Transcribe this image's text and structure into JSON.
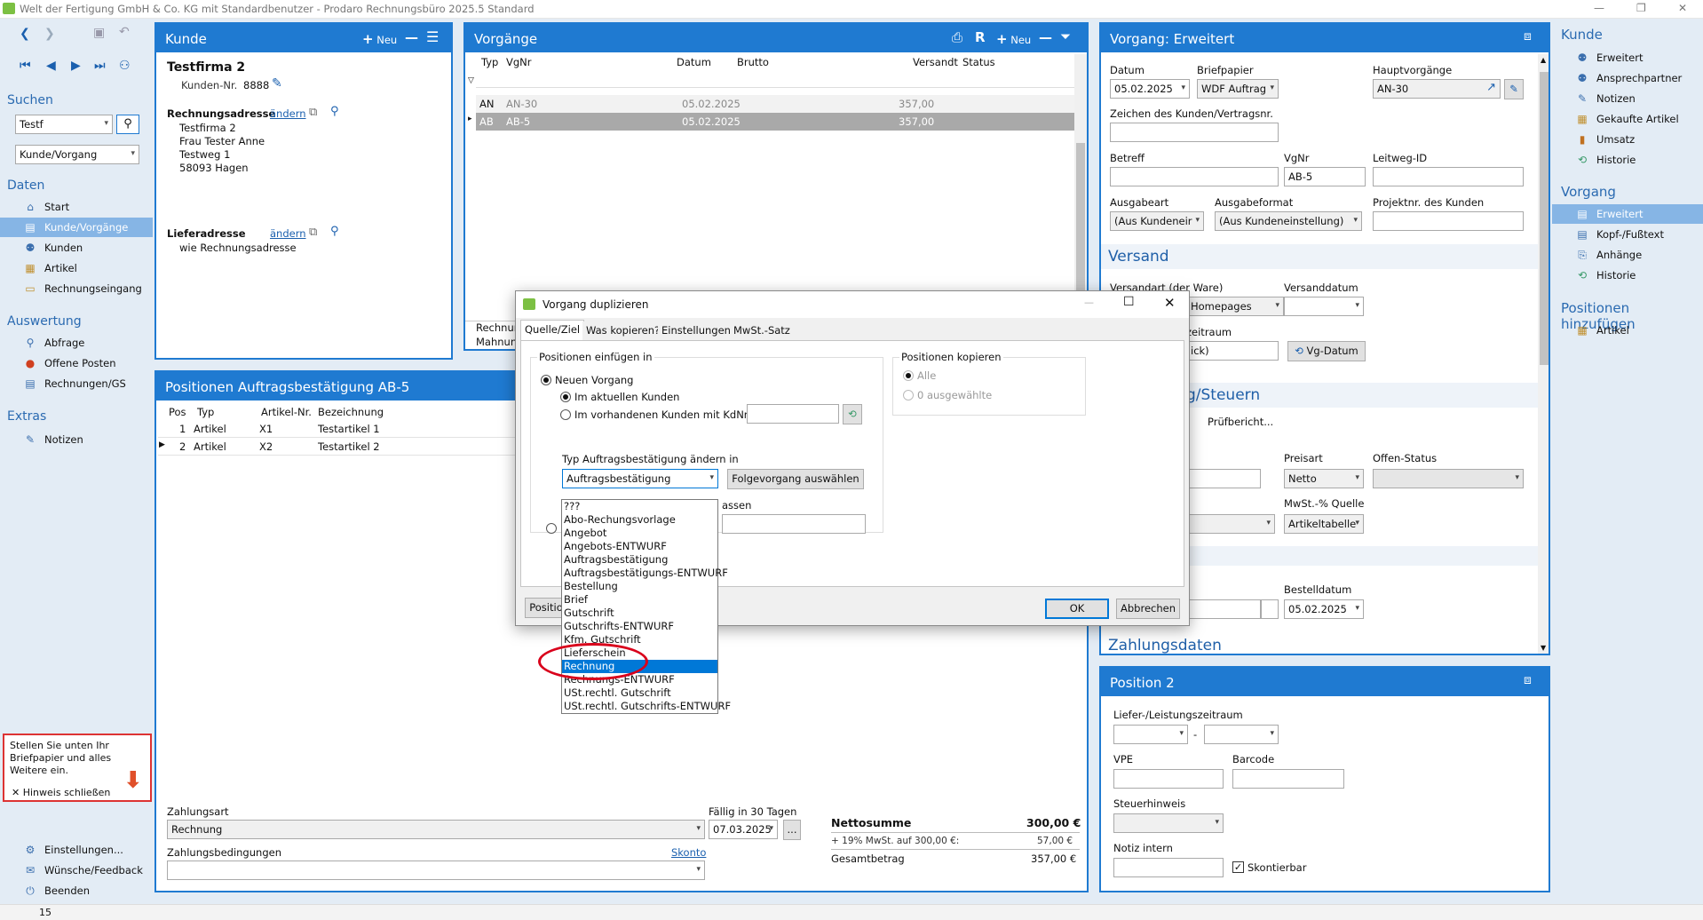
{
  "window": {
    "title": "Welt der Fertigung GmbH & Co. KG mit Standardbenutzer  -  Prodaro Rechnungsbüro 2025.5 Standard",
    "minimize": "—",
    "restore": "❐",
    "close": "✕"
  },
  "left_nav": {
    "search_heading": "Suchen",
    "search_value": "Testf",
    "search_scope": "Kunde/Vorgang",
    "daten_heading": "Daten",
    "daten_items": [
      "Start",
      "Kunde/Vorgänge",
      "Kunden",
      "Artikel",
      "Rechnungseingang"
    ],
    "auswertung_heading": "Auswertung",
    "auswertung_items": [
      "Abfrage",
      "Offene Posten",
      "Rechnungen/GS"
    ],
    "extras_heading": "Extras",
    "extras_items": [
      "Notizen"
    ],
    "bottom_items": [
      "Einstellungen...",
      "Wünsche/Feedback",
      "Beenden"
    ],
    "hint_text": "Stellen Sie unten Ihr Briefpapier und alles Weitere ein.",
    "hint_close": "Hinweis schließen"
  },
  "kunde": {
    "header": "Kunde",
    "new_label": "Neu",
    "name": "Testfirma 2",
    "kundennr_label": "Kunden-Nr.",
    "kundennr": "8888",
    "rechnungsadresse_label": "Rechnungsadresse",
    "aendern": "ändern",
    "address": [
      "Testfirma 2",
      "Frau Tester Anne",
      "Testweg 1",
      "58093 Hagen"
    ],
    "lieferadresse_label": "Lieferadresse",
    "lieferadresse": "wie Rechnungsadresse"
  },
  "vorgaenge": {
    "header": "Vorgänge",
    "r_label": "R",
    "new_label": "Neu",
    "columns": [
      "Typ",
      "VgNr",
      "Datum",
      "Brutto",
      "Versandt",
      "Status"
    ],
    "rows": [
      {
        "typ": "AN",
        "vgnr": "AN-30",
        "datum": "05.02.2025",
        "brutto": "357,00"
      },
      {
        "typ": "AB",
        "vgnr": "AB-5",
        "datum": "05.02.2025",
        "brutto": "357,00"
      }
    ],
    "cut_labels": [
      "Rechnur",
      "Mahnun"
    ]
  },
  "positionen": {
    "header": "Positionen Auftragsbestätigung AB-5",
    "columns": [
      "Pos",
      "Typ",
      "Artikel-Nr.",
      "Bezeichnung"
    ],
    "rows": [
      {
        "pos": "1",
        "typ": "Artikel",
        "nr": "X1",
        "bez": "Testartikel 1"
      },
      {
        "pos": "2",
        "typ": "Artikel",
        "nr": "X2",
        "bez": "Testartikel 2"
      }
    ],
    "zahlungsart_label": "Zahlungsart",
    "zahlungsart": "Rechnung",
    "faellig_label": "Fällig in 30 Tagen",
    "faellig_date": "07.03.2025",
    "more": "...",
    "zahlungsbed_label": "Zahlungsbedingungen",
    "skonto": "Skonto",
    "netto_label": "Nettosumme",
    "netto_value": "300,00 €",
    "mwst_label": "+ 19% MwSt. auf 300,00 €:",
    "mwst_value": "57,00 €",
    "gesamt_label": "Gesamtbetrag",
    "gesamt_value": "357,00 €"
  },
  "erweitert": {
    "header": "Vorgang: Erweitert",
    "datum_label": "Datum",
    "datum": "05.02.2025",
    "briefpapier_label": "Briefpapier",
    "briefpapier": "WDF Auftrag",
    "hauptvorgaenge_label": "Hauptvorgänge",
    "hauptvorgaenge": "AN-30",
    "zeichen_label": "Zeichen des Kunden/Vertragsnr.",
    "betreff_label": "Betreff",
    "vgnr_label": "VgNr",
    "vgnr": "AB-5",
    "leitweg_label": "Leitweg-ID",
    "ausgabeart_label": "Ausgabeart",
    "ausgabeart": "(Aus Kundeneir",
    "ausgabeformat_label": "Ausgabeformat",
    "ausgabeformat": "(Aus Kundeneinstellung)",
    "projektnr_label": "Projektnr. des Kunden",
    "versand_heading": "Versand",
    "versandart_label": "Versandart (der Ware)",
    "versandart": "Homepages",
    "versanddatum_label": "Versanddatum",
    "zeitraum_label_cut": "zeitraum",
    "zeitraum_value_cut": "ick)",
    "vgdatum_btn": "Vg-Datum",
    "steuern_heading_cut": "g/Steuern",
    "pruefbericht": "Prüfbericht...",
    "preisart_label": "Preisart",
    "preisart": "Netto",
    "offen_label": "Offen-Status",
    "mwst_quelle_label": "MwSt.-% Quelle",
    "mwst_quelle": "Artikeltabelle",
    "bestelldatum_label": "Bestelldatum",
    "bestelldatum": "05.02.2025",
    "zahlungsdaten_heading": "Zahlungsdaten"
  },
  "position2": {
    "header": "Position 2",
    "liefer_label": "Liefer-/Leistungszeitraum",
    "dash": "-",
    "vpe_label": "VPE",
    "barcode_label": "Barcode",
    "steuerhinweis_label": "Steuerhinweis",
    "notiz_label": "Notiz intern",
    "skontierbar_label": "Skontierbar"
  },
  "right_nav": {
    "kunde_heading": "Kunde",
    "kunde_items": [
      "Erweitert",
      "Ansprechpartner",
      "Notizen",
      "Gekaufte Artikel",
      "Umsatz",
      "Historie"
    ],
    "vorgang_heading": "Vorgang",
    "vorgang_items": [
      "Erweitert",
      "Kopf-/Fußtext",
      "Anhänge",
      "Historie"
    ],
    "pos_heading": "Positionen hinzufügen",
    "pos_items": [
      "Artikel"
    ]
  },
  "dialog": {
    "title": "Vorgang duplizieren",
    "tabs": [
      "Quelle/Ziel",
      "Was kopieren?",
      "Einstellungen",
      "MwSt.-Satz"
    ],
    "einfuegen_group": "Positionen einfügen in",
    "neuer_vorgang": "Neuen Vorgang",
    "im_aktuellen": "Im aktuellen Kunden",
    "im_vorhandenen": "Im vorhandenen Kunden mit KdNr",
    "typ_label": "Typ Auftragsbestätigung ändern in",
    "typ_value": "Auftragsbestätigung",
    "folge_btn": "Folgevorgang auswählen",
    "cut_text": "assen",
    "kopieren_group": "Positionen kopieren",
    "alle": "Alle",
    "ausgewaehlte": "0 ausgewählte",
    "bottom_btn_cut": "Positio",
    "ok": "OK",
    "cancel": "Abbrechen",
    "options": [
      "???",
      "Abo-Rechungsvorlage",
      "Angebot",
      "Angebots-ENTWURF",
      "Auftragsbestätigung",
      "Auftragsbestätigungs-ENTWURF",
      "Bestellung",
      "Brief",
      "Gutschrift",
      "Gutschrifts-ENTWURF",
      "Kfm. Gutschrift",
      "Lieferschein",
      "Rechnung",
      "Rechnungs-ENTWURF",
      "USt.rechtl. Gutschrift",
      "USt.rechtl. Gutschrifts-ENTWURF"
    ],
    "selected_option": "Rechnung"
  },
  "status": {
    "value": "15"
  },
  "colors": {
    "accent": "#1f7ad1",
    "selection": "#86b5e5",
    "highlight_circle": "#d9001b"
  }
}
